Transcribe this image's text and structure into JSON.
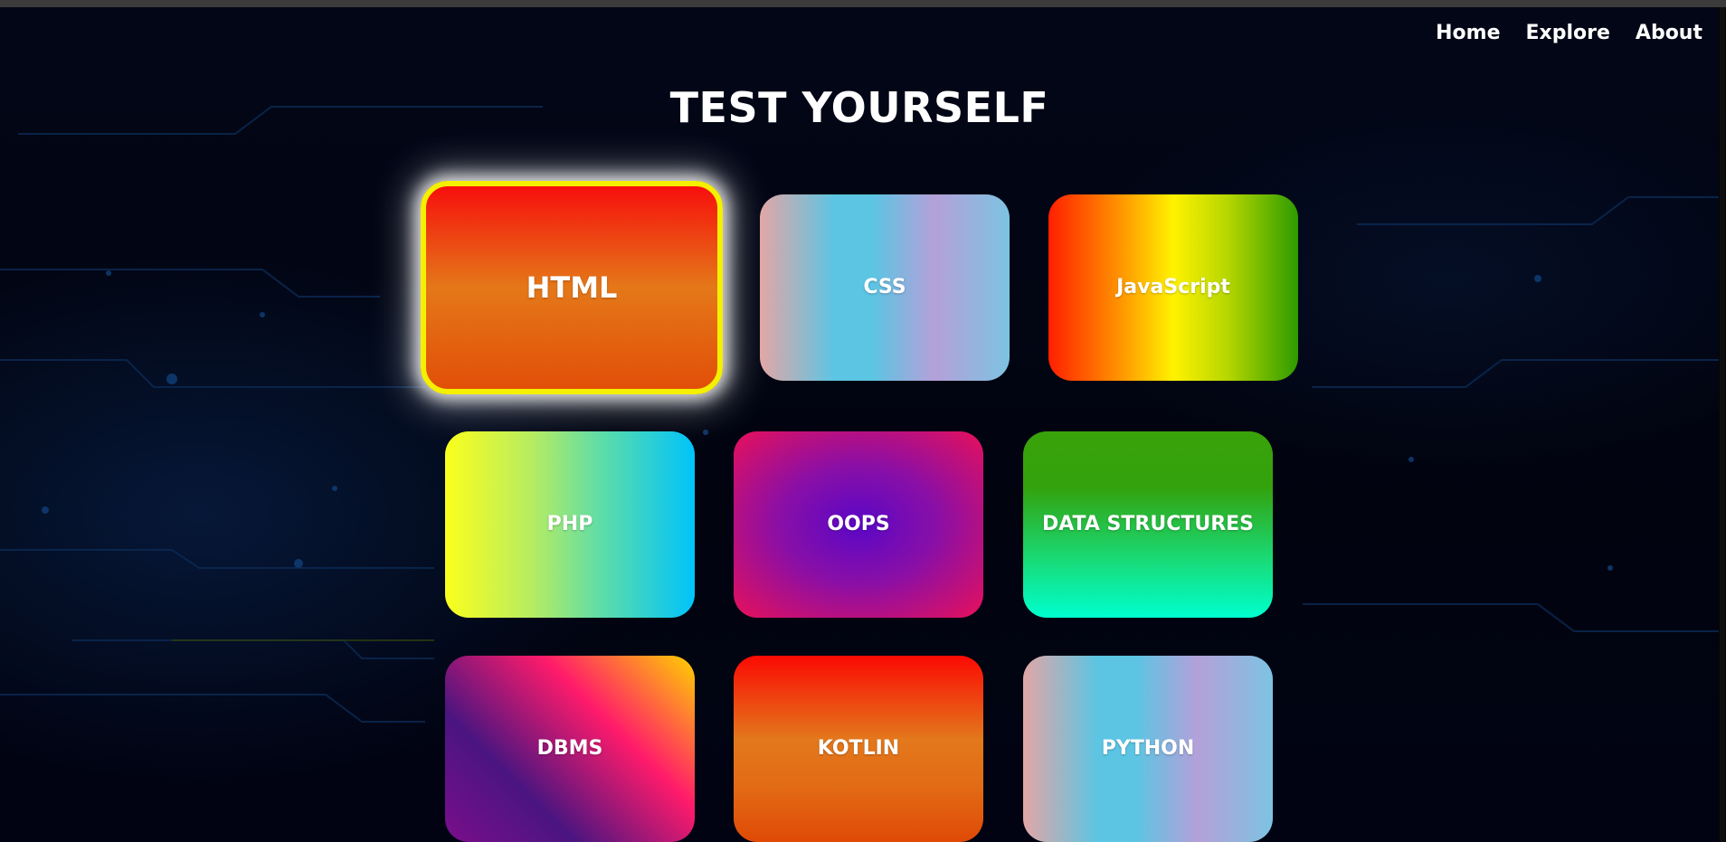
{
  "nav": {
    "items": [
      {
        "label": "Home"
      },
      {
        "label": "Explore"
      },
      {
        "label": "About"
      }
    ]
  },
  "page": {
    "title": "TEST YOURSELF"
  },
  "cards": {
    "html": "HTML",
    "css": "CSS",
    "javascript": "JavaScript",
    "php": "PHP",
    "oops": "OOPS",
    "data_structures": "DATA STRUCTURES",
    "dbms": "DBMS",
    "kotlin": "KOTLIN",
    "python": "PYTHON"
  },
  "colors": {
    "background": "#01030f",
    "highlight_border": "#f5ef00",
    "text": "#ffffff"
  }
}
